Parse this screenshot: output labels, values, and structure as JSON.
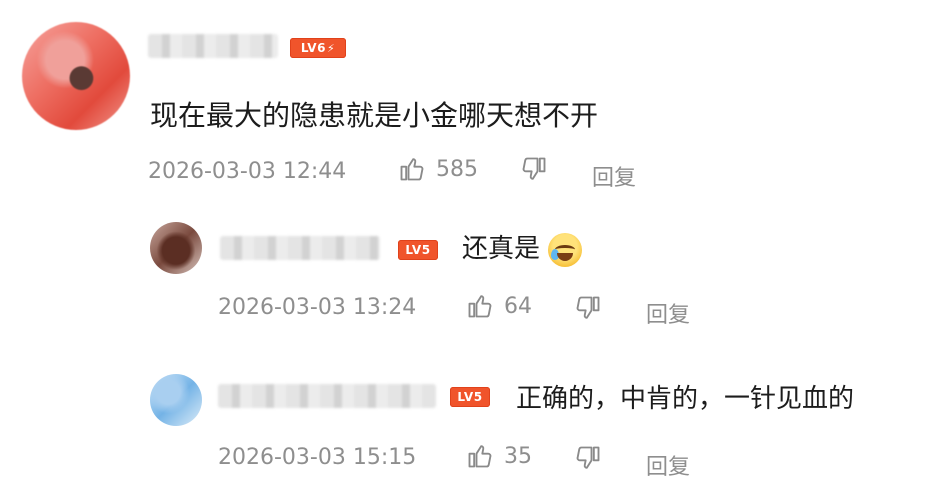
{
  "comments": [
    {
      "level": "LV6",
      "level_suffix": "⚡",
      "text": "现在最大的隐患就是小金哪天想不开",
      "time": "2026-03-03 12:44",
      "likes": "585",
      "reply_label": "回复"
    },
    {
      "level": "LV5",
      "text": "还真是",
      "emoji": "laughing-crying-emoji",
      "time": "2026-03-03 13:24",
      "likes": "64",
      "reply_label": "回复"
    },
    {
      "level": "LV5",
      "text": "正确的，中肯的，一针见血的",
      "time": "2026-03-03 15:15",
      "likes": "35",
      "reply_label": "回复"
    }
  ],
  "colors": {
    "level_badge": "#f0542b",
    "meta_text": "#8e8e8e"
  }
}
